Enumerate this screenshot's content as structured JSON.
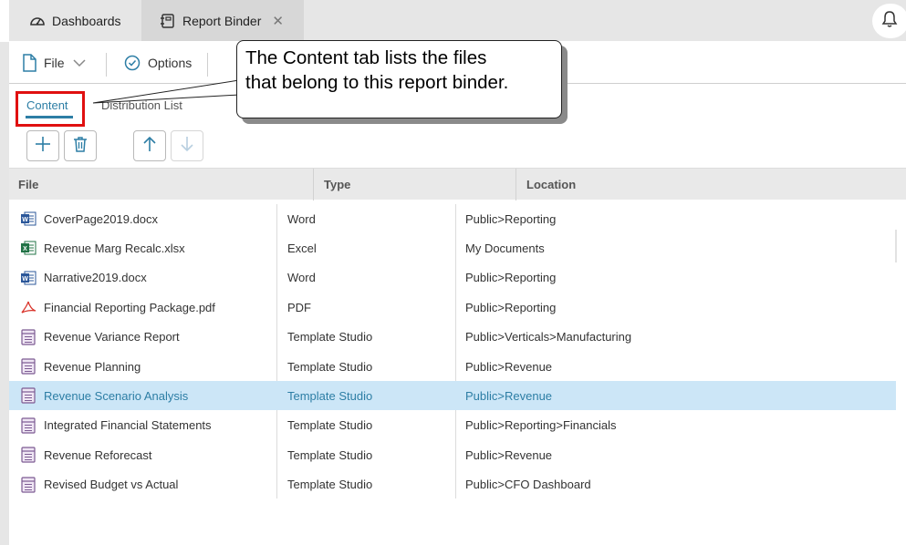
{
  "tabs": [
    {
      "label": "Dashboards",
      "icon": "gauge-icon"
    },
    {
      "label": "Report Binder",
      "icon": "binder-icon",
      "close": "✕"
    }
  ],
  "toolbar": {
    "file_label": "File",
    "options_label": "Options"
  },
  "subtabs": {
    "content": "Content",
    "distribution": "Distribution List"
  },
  "grid": {
    "headers": {
      "file": "File",
      "type": "Type",
      "location": "Location"
    },
    "rows": [
      {
        "file": "CoverPage2019.docx",
        "type": "Word",
        "location": "Public>Reporting",
        "icon": "word-icon"
      },
      {
        "file": "Revenue Marg Recalc.xlsx",
        "type": "Excel",
        "location": "My Documents",
        "icon": "excel-icon"
      },
      {
        "file": "Narrative2019.docx",
        "type": "Word",
        "location": "Public>Reporting",
        "icon": "word-icon"
      },
      {
        "file": "Financial Reporting Package.pdf",
        "type": "PDF",
        "location": "Public>Reporting",
        "icon": "pdf-icon"
      },
      {
        "file": "Revenue Variance Report",
        "type": "Template Studio",
        "location": "Public>Verticals>Manufacturing",
        "icon": "template-icon"
      },
      {
        "file": "Revenue Planning",
        "type": "Template Studio",
        "location": "Public>Revenue",
        "icon": "template-icon"
      },
      {
        "file": "Revenue Scenario Analysis",
        "type": "Template Studio",
        "location": "Public>Revenue",
        "icon": "template-icon",
        "selected": true
      },
      {
        "file": "Integrated Financial Statements",
        "type": "Template Studio",
        "location": "Public>Reporting>Financials",
        "icon": "template-icon"
      },
      {
        "file": "Revenue Reforecast",
        "type": "Template Studio",
        "location": "Public>Revenue",
        "icon": "template-icon"
      },
      {
        "file": "Revised Budget vs Actual",
        "type": "Template Studio",
        "location": "Public>CFO Dashboard",
        "icon": "template-icon"
      }
    ]
  },
  "callout": {
    "line1": "The Content tab lists the files",
    "line2": "that belong to this report binder."
  },
  "colors": {
    "accent": "#2d7ea5",
    "selected_row": "#cce6f7",
    "highlight_border": "#e01010"
  }
}
